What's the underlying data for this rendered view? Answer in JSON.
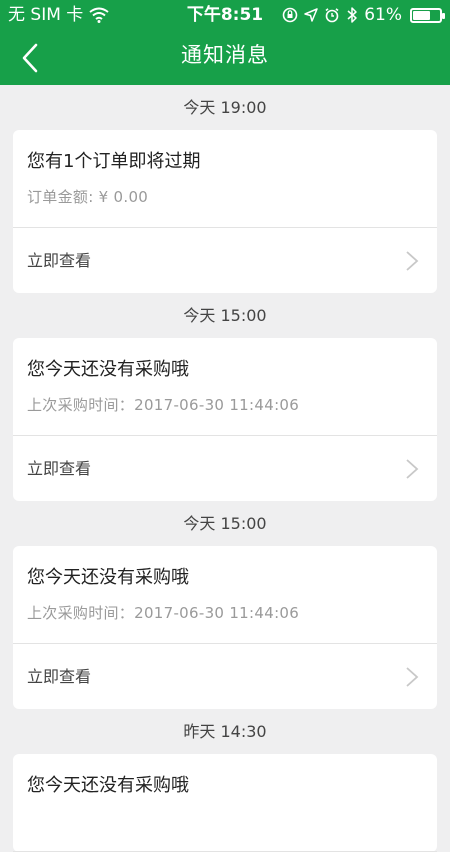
{
  "status_bar": {
    "carrier": "无 SIM 卡",
    "time": "下午8:51",
    "battery_percent": "61%",
    "battery_level": 0.61
  },
  "header": {
    "title": "通知消息"
  },
  "notifications": [
    {
      "time": "今天 19:00",
      "title": "您有1个订单即将过期",
      "detail": "订单金额: ¥ 0.00",
      "action": "立即查看"
    },
    {
      "time": "今天 15:00",
      "title": "您今天还没有采购哦",
      "detail": "上次采购时间：2017-06-30 11:44:06",
      "action": "立即查看"
    },
    {
      "time": "今天 15:00",
      "title": "您今天还没有采购哦",
      "detail": "上次采购时间：2017-06-30 11:44:06",
      "action": "立即查看"
    },
    {
      "time": "昨天 14:30",
      "title": "您今天还没有采购哦"
    }
  ],
  "colors": {
    "brand": "#17a049",
    "background": "#efeff0"
  }
}
